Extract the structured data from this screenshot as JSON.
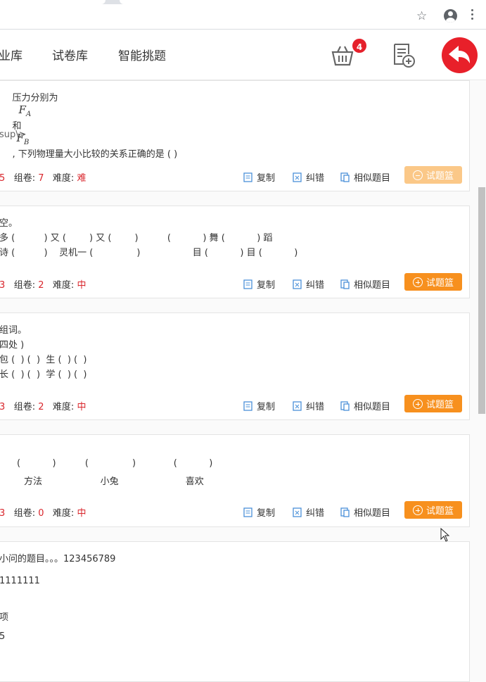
{
  "browser": {
    "star_icon": "star-icon",
    "profile_icon": "profile-icon",
    "menu_icon": "kebab-menu-icon"
  },
  "nav": {
    "items": [
      "业库",
      "试卷库",
      "智能挑题"
    ],
    "basket_count": "4",
    "accent": "#f7901e",
    "badge_color": "#e5202b"
  },
  "labels": {
    "copy": "复制",
    "correct": "纠错",
    "similar": "相似题目",
    "basket": "试题篮",
    "group_label": "组卷:",
    "difficulty_label": "难度:"
  },
  "cards": [
    {
      "lines": [
        "压力分别为",
        "和",
        ", 下列物理量大小比较的关系正确的是 ( )",
        "sup\\>"
      ],
      "math": [
        "F_A",
        "F_B"
      ],
      "count": "5",
      "group": "7",
      "difficulty": "难",
      "in_basket": true
    },
    {
      "lines": [
        "空。",
        "多 (          ) 又 (        ) 又 (        )          (           ) 舞 (           ) 蹈",
        "诗 (          )    灵机一 (               )                  目 (           ) 目 (           )"
      ],
      "count": "3",
      "group": "2",
      "difficulty": "中",
      "in_basket": false
    },
    {
      "lines": [
        "组词。",
        "四处 )",
        "包 (  ) (  )  生 (  ) (  )",
        "长 (  ) (  )  学 (  ) (  )"
      ],
      "count": "3",
      "group": "2",
      "difficulty": "中",
      "in_basket": false
    },
    {
      "lines": [
        "(           )          (               )             (           )",
        "方法                    小兔                       喜欢"
      ],
      "count": "3",
      "group": "0",
      "difficulty": "中",
      "in_basket": false
    },
    {
      "lines": [
        "小问的题目。。。123456789",
        "1111111",
        "项",
        "5"
      ]
    }
  ]
}
